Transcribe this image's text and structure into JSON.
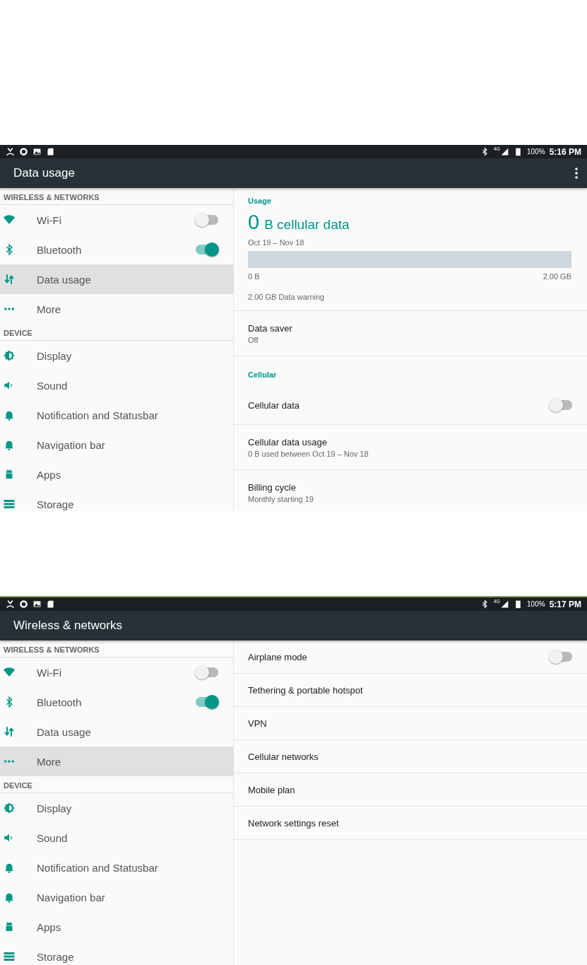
{
  "screens": [
    {
      "status_bar": {
        "network": "4G",
        "battery": "100%",
        "time": "5:16 PM"
      },
      "toolbar": {
        "title": "Data usage",
        "overflow_menu": true
      },
      "sidebar": {
        "sections": [
          {
            "header": "WIRELESS & NETWORKS",
            "items": [
              {
                "label": "Wi-Fi",
                "kind": "switch",
                "on": false,
                "selected": false
              },
              {
                "label": "Bluetooth",
                "kind": "switch",
                "on": true,
                "selected": false
              },
              {
                "label": "Data usage",
                "kind": "link",
                "selected": true
              },
              {
                "label": "More",
                "kind": "link",
                "selected": false
              }
            ]
          },
          {
            "header": "DEVICE",
            "items": [
              {
                "label": "Display",
                "kind": "link",
                "selected": false
              },
              {
                "label": "Sound",
                "kind": "link",
                "selected": false
              },
              {
                "label": "Notification and Statusbar",
                "kind": "link",
                "selected": false
              },
              {
                "label": "Navigation bar",
                "kind": "link",
                "selected": false
              },
              {
                "label": "Apps",
                "kind": "link",
                "selected": false
              },
              {
                "label": "Storage",
                "kind": "link",
                "selected": false
              }
            ]
          }
        ]
      },
      "content": [
        {
          "kind": "usage",
          "header": "Usage",
          "amount": "0",
          "unit": "B cellular data",
          "period": "Oct 19 – Nov 18",
          "meter": {
            "level": 0,
            "min_label": "0 B",
            "max_label": "2.00 GB"
          },
          "warning": "2.00 GB Data warning"
        },
        {
          "kind": "pref",
          "title": "Data saver",
          "summary": "Off"
        },
        {
          "kind": "category",
          "title": "Cellular"
        },
        {
          "kind": "switch",
          "title": "Cellular data",
          "on": false
        },
        {
          "kind": "pref",
          "title": "Cellular data usage",
          "summary": "0 B used between Oct 19 – Nov 18"
        },
        {
          "kind": "pref",
          "title": "Billing cycle",
          "summary": "Monthly starting 19"
        }
      ]
    },
    {
      "status_bar": {
        "network": "4G",
        "battery": "100%",
        "time": "5:17 PM"
      },
      "toolbar": {
        "title": "Wireless & networks",
        "overflow_menu": false
      },
      "sidebar": {
        "sections": [
          {
            "header": "WIRELESS & NETWORKS",
            "items": [
              {
                "label": "Wi-Fi",
                "kind": "switch",
                "on": false,
                "selected": false
              },
              {
                "label": "Bluetooth",
                "kind": "switch",
                "on": true,
                "selected": false
              },
              {
                "label": "Data usage",
                "kind": "link",
                "selected": false
              },
              {
                "label": "More",
                "kind": "link",
                "selected": true
              }
            ]
          },
          {
            "header": "DEVICE",
            "items": [
              {
                "label": "Display",
                "kind": "link",
                "selected": false
              },
              {
                "label": "Sound",
                "kind": "link",
                "selected": false
              },
              {
                "label": "Notification and Statusbar",
                "kind": "link",
                "selected": false
              },
              {
                "label": "Navigation bar",
                "kind": "link",
                "selected": false
              },
              {
                "label": "Apps",
                "kind": "link",
                "selected": false
              },
              {
                "label": "Storage",
                "kind": "link",
                "selected": false
              }
            ]
          }
        ]
      },
      "content": [
        {
          "kind": "switch",
          "title": "Airplane mode",
          "on": false
        },
        {
          "kind": "pref",
          "title": "Tethering & portable hotspot"
        },
        {
          "kind": "pref",
          "title": "VPN"
        },
        {
          "kind": "pref",
          "title": "Cellular networks"
        },
        {
          "kind": "pref",
          "title": "Mobile plan"
        },
        {
          "kind": "pref",
          "title": "Network settings reset"
        }
      ]
    }
  ]
}
